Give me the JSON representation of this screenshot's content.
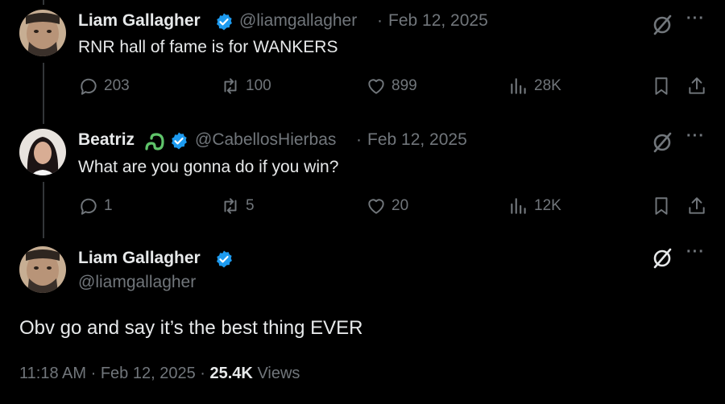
{
  "tweets": [
    {
      "name": "Liam Gallagher",
      "handle": "@liamgallagher",
      "date": "Feb 12, 2025",
      "text": "RNR hall of fame is for WANKERS",
      "replies": "203",
      "reposts": "100",
      "likes": "899",
      "views": "28K"
    },
    {
      "name": "Beatriz",
      "handle": "@CabellosHierbas",
      "date": "Feb 12, 2025",
      "text": "What are you gonna do if you win?",
      "replies": "1",
      "reposts": "5",
      "likes": "20",
      "views": "12K"
    }
  ],
  "main": {
    "name": "Liam Gallagher",
    "handle": "@liamgallagher",
    "text": "Obv go and say it’s the best thing EVER",
    "time": "11:18 AM",
    "date": "Feb 12, 2025",
    "views_count": "25.4K",
    "views_label": "Views"
  },
  "separator": "·",
  "more_label": "···",
  "colors": {
    "background": "#000000",
    "text": "#e7e9ea",
    "muted": "#71767b",
    "verified": "#1d9bf0",
    "beatriz_emoji": "#5fc46a"
  },
  "icons": [
    "verified-badge-icon",
    "reply-icon",
    "repost-icon",
    "like-icon",
    "views-icon",
    "bookmark-icon",
    "share-icon",
    "grok-icon",
    "more-icon"
  ]
}
